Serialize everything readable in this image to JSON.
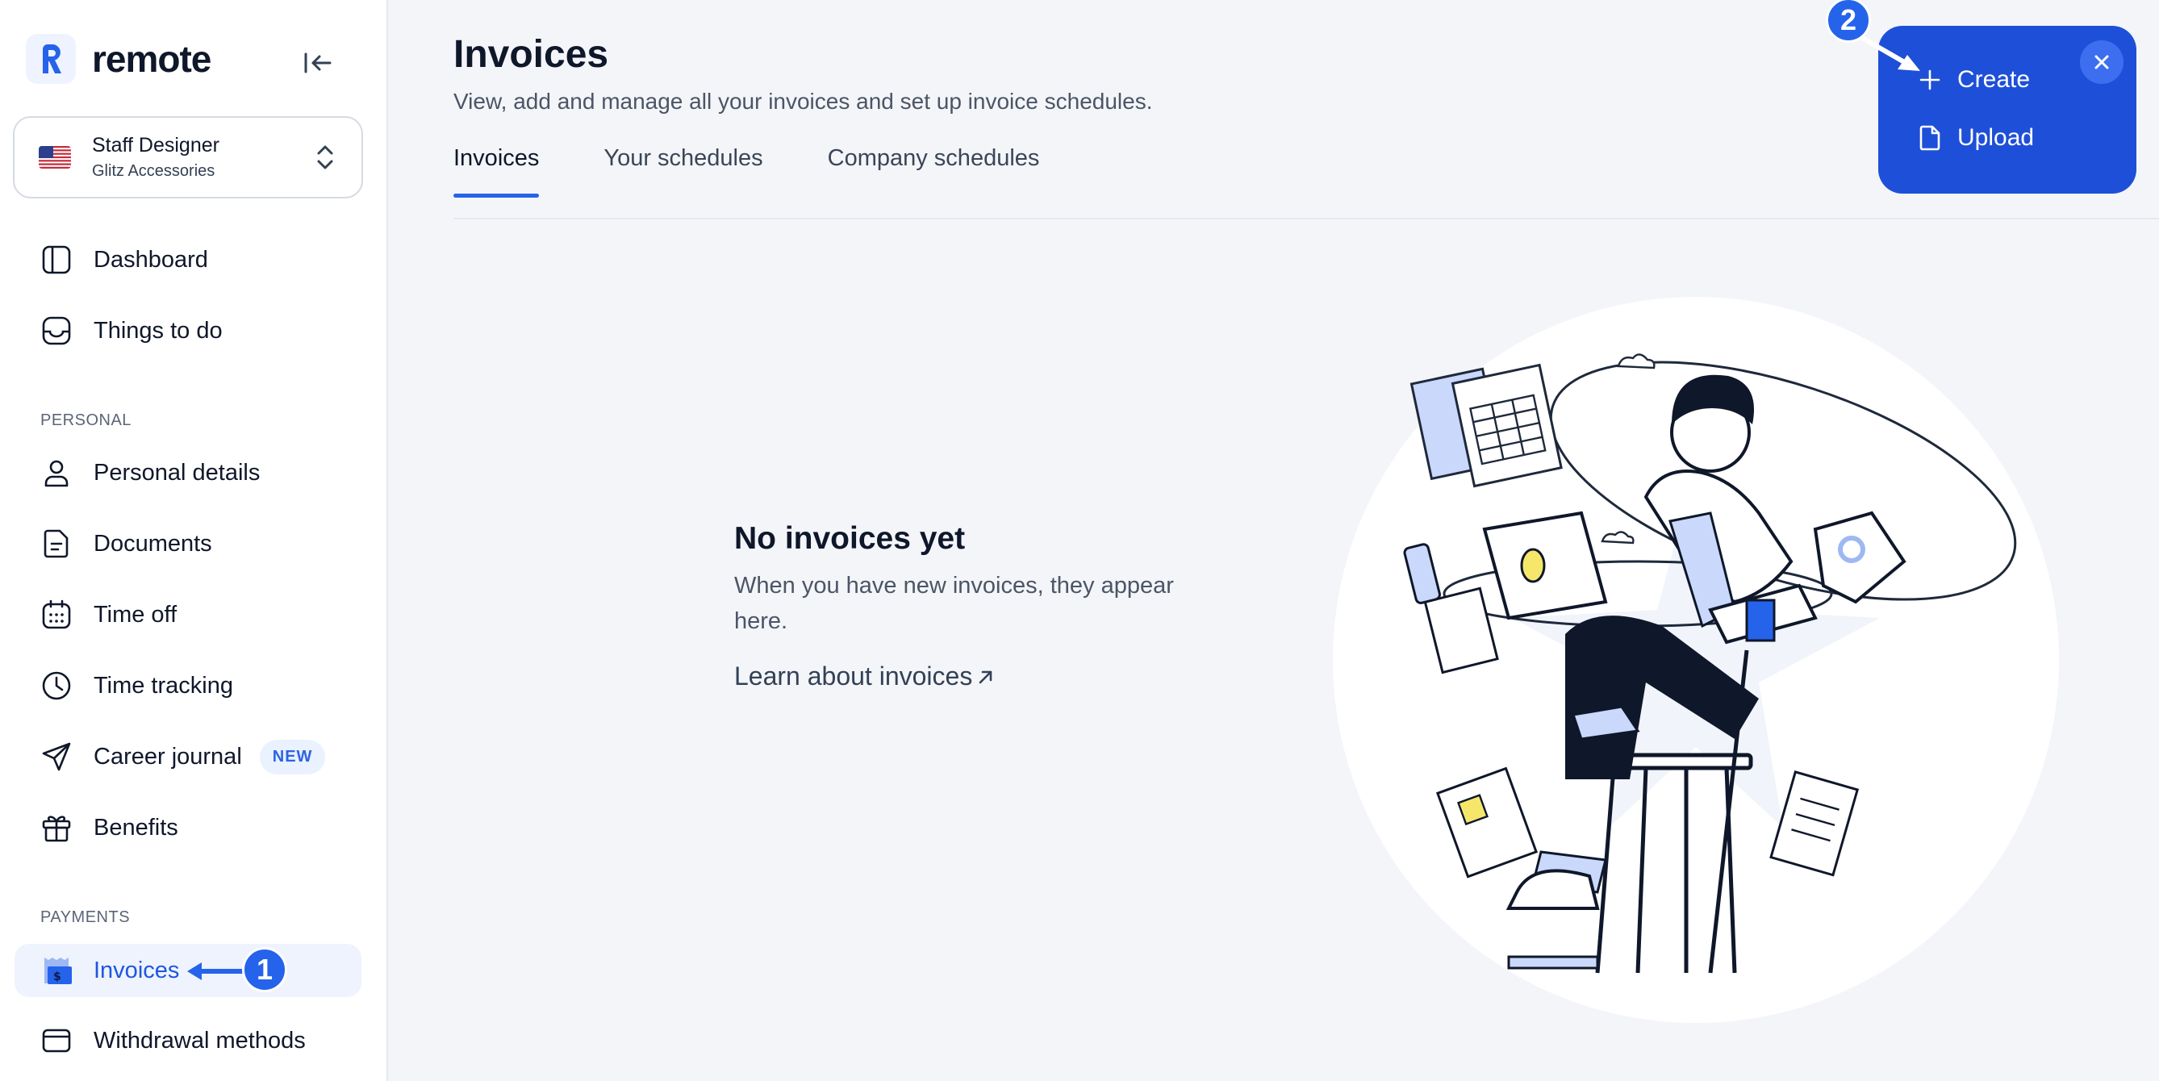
{
  "brand": {
    "name": "remote"
  },
  "profile": {
    "name": "Staff Designer",
    "company": "Glitz Accessories"
  },
  "nav": {
    "dashboard": "Dashboard",
    "things_to_do": "Things to do",
    "section_personal": "PERSONAL",
    "personal_details": "Personal details",
    "documents": "Documents",
    "time_off": "Time off",
    "time_tracking": "Time tracking",
    "career_journal": "Career journal",
    "career_badge": "NEW",
    "benefits": "Benefits",
    "section_payments": "PAYMENTS",
    "invoices": "Invoices",
    "withdrawal_methods": "Withdrawal methods"
  },
  "header": {
    "title": "Invoices",
    "subtitle": "View, add and manage all your invoices and set up invoice schedules."
  },
  "tabs": [
    {
      "label": "Invoices",
      "active": true
    },
    {
      "label": "Your schedules",
      "active": false
    },
    {
      "label": "Company schedules",
      "active": false
    }
  ],
  "empty_state": {
    "title": "No invoices yet",
    "description": "When you have new invoices, they appear here.",
    "link": "Learn about invoices"
  },
  "create_menu": {
    "items": [
      {
        "label": "Create",
        "icon": "plus-icon"
      },
      {
        "label": "Upload",
        "icon": "file-icon"
      }
    ]
  },
  "steps": {
    "one": "1",
    "two": "2"
  },
  "colors": {
    "accent": "#2563eb",
    "menu_bg": "#1e4fd8",
    "active_nav_bg": "#eef3fd",
    "page_bg": "#f3f5f9"
  }
}
